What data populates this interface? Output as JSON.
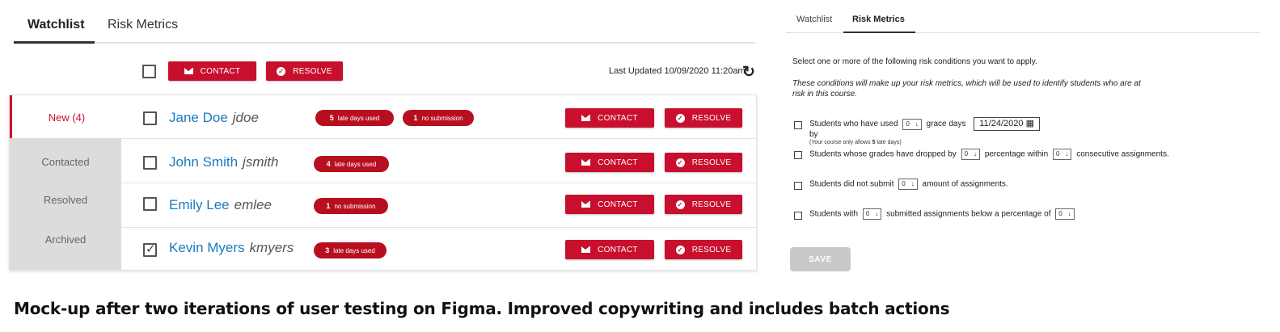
{
  "left": {
    "tabs": [
      "Watchlist",
      "Risk Metrics"
    ],
    "batch": {
      "contact": "CONTACT",
      "resolve": "RESOLVE"
    },
    "last_updated": "Last Updated 10/09/2020 11:20am",
    "sidebar": [
      "New (4)",
      "Contacted",
      "Resolved",
      "Archived"
    ],
    "rows": [
      {
        "name": "Jane Doe",
        "user": "jdoe",
        "pills": [
          {
            "n": "5",
            "t": "late days used"
          },
          {
            "n": "1",
            "t": "no submission"
          }
        ],
        "checked": false
      },
      {
        "name": "John Smith",
        "user": "jsmith",
        "pills": [
          {
            "n": "4",
            "t": "late days used"
          }
        ],
        "checked": false
      },
      {
        "name": "Emily Lee",
        "user": "emlee",
        "pills": [
          {
            "n": "1",
            "t": "no submission"
          }
        ],
        "checked": false
      },
      {
        "name": "Kevin Myers",
        "user": "kmyers",
        "pills": [
          {
            "n": "3",
            "t": "late days used"
          }
        ],
        "checked": true
      }
    ],
    "row_contact": "CONTACT",
    "row_resolve": "RESOLVE"
  },
  "right": {
    "tabs": [
      "Watchlist",
      "Risk Metrics"
    ],
    "intro": "Select one or more of the following risk conditions you want to apply.",
    "desc_line1": "These conditions will make up your risk metrics, which will be used to identify students who are at",
    "desc_line2": "risk in this course.",
    "c1": {
      "a": "Students who have used",
      "sel": "0",
      "b": "grace days",
      "date": "11/24/2020",
      "by": "by",
      "note_pre": "(Your course only allows ",
      "note_num": "5",
      "note_post": " late days)"
    },
    "c2": {
      "a": "Students whose grades have dropped by",
      "sel1": "0",
      "b": "percentage within",
      "sel2": "0",
      "c": "consecutive assignments."
    },
    "c3": {
      "a": "Students did not submit",
      "sel": "0",
      "b": "amount of assignments."
    },
    "c4": {
      "a": "Students with",
      "sel1": "0",
      "b": "submitted assignments below a percentage of",
      "sel2": "0"
    },
    "save": "SAVE"
  },
  "caption": "Mock-up after two iterations of user testing on Figma. Improved copywriting and includes batch actions",
  "colors": {
    "accent": "#c8102e",
    "link": "#1a7bbf",
    "sidebar": "#dcdcdc"
  },
  "icons": {
    "contact": "envelope-icon",
    "resolve": "check-circle-icon",
    "refresh": "refresh-icon",
    "calendar": "calendar-icon",
    "select": "arrow-down-icon"
  }
}
